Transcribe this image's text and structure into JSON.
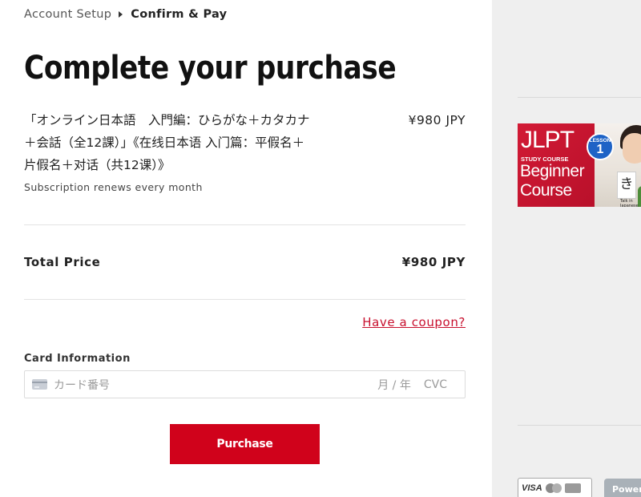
{
  "breadcrumb": {
    "step1": "Account Setup",
    "step2": "Confirm & Pay"
  },
  "title": "Complete your purchase",
  "product": {
    "name": "「オンライン日本語　入門編：ひらがな＋カタカナ＋会話（全12課）」《在线日本语 入门篇：平假名＋片假名＋对话（共12课）》",
    "price": "¥980 JPY",
    "note": "Subscription renews every month"
  },
  "total": {
    "label": "Total Price",
    "value": "¥980 JPY"
  },
  "coupon": {
    "label": "Have a coupon?"
  },
  "card": {
    "label": "Card Information",
    "number_placeholder": "カード番号",
    "expiry_placeholder": "月 / 年",
    "cvc_placeholder": "CVC"
  },
  "purchase_button": "Purchase",
  "course_thumbnail": {
    "title": "JLPT",
    "subtitle": "STUDY COURSE",
    "course_name_line1": "Beginner",
    "course_name_line2": "Course",
    "lesson_label": "LESSON",
    "lesson_number": "1",
    "kana": "き",
    "brand": "Talk in Japanese"
  },
  "payment": {
    "visa": "VISA",
    "powered": "Powered"
  },
  "colors": {
    "accent": "#d0021b",
    "link": "#c8102e",
    "sidebar_bg": "#efefef"
  }
}
